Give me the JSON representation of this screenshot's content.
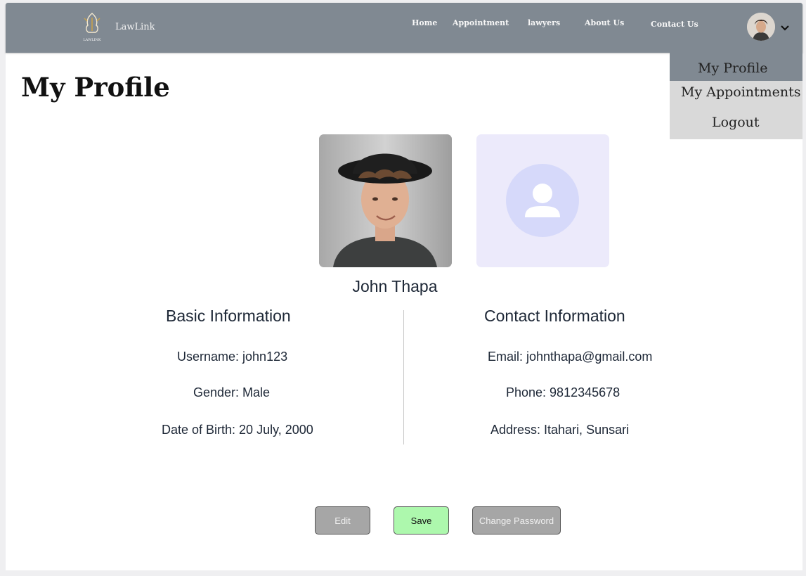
{
  "navbar": {
    "brand": "LawLink",
    "logo_caption": "LAWLINK",
    "links": [
      "Home",
      "Appointment",
      "lawyers",
      "About Us",
      "Contact Us"
    ]
  },
  "dropdown": {
    "items": [
      "My Profile",
      "My Appointments",
      "Logout"
    ]
  },
  "page_title": "My Profile",
  "profile": {
    "name": "John Thapa"
  },
  "basic_info": {
    "title": "Basic Information",
    "username": "Username: john123",
    "gender": "Gender: Male",
    "dob": "Date of Birth: 20 July, 2000"
  },
  "contact_info": {
    "title": "Contact Information",
    "email": "Email: johnthapa@gmail.com",
    "phone": "Phone: 9812345678",
    "address": "Address: Itahari, Sunsari"
  },
  "actions": {
    "edit": "Edit",
    "save": "Save",
    "change_password": "Change Password"
  },
  "colors": {
    "navbar": "#808992",
    "dropdown": "#d9d9d9",
    "save_button": "#adf8ad",
    "neutral_button": "#a6a6a6",
    "placeholder_bg": "#eceafb"
  },
  "icons": {
    "logo": "lawlink-logo-icon",
    "user_placeholder": "user-placeholder-icon",
    "chevron": "chevron-down-icon"
  }
}
